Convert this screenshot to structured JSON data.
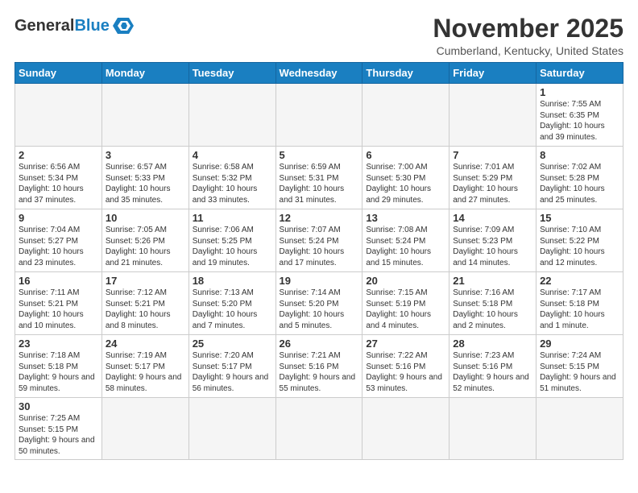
{
  "header": {
    "logo": {
      "text_general": "General",
      "text_blue": "Blue"
    },
    "title": "November 2025",
    "subtitle": "Cumberland, Kentucky, United States"
  },
  "days_of_week": [
    "Sunday",
    "Monday",
    "Tuesday",
    "Wednesday",
    "Thursday",
    "Friday",
    "Saturday"
  ],
  "weeks": [
    [
      {
        "day": "",
        "info": "",
        "empty": true
      },
      {
        "day": "",
        "info": "",
        "empty": true
      },
      {
        "day": "",
        "info": "",
        "empty": true
      },
      {
        "day": "",
        "info": "",
        "empty": true
      },
      {
        "day": "",
        "info": "",
        "empty": true
      },
      {
        "day": "",
        "info": "",
        "empty": true
      },
      {
        "day": "1",
        "info": "Sunrise: 7:55 AM\nSunset: 6:35 PM\nDaylight: 10 hours\nand 39 minutes."
      }
    ],
    [
      {
        "day": "2",
        "info": "Sunrise: 6:56 AM\nSunset: 5:34 PM\nDaylight: 10 hours\nand 37 minutes."
      },
      {
        "day": "3",
        "info": "Sunrise: 6:57 AM\nSunset: 5:33 PM\nDaylight: 10 hours\nand 35 minutes."
      },
      {
        "day": "4",
        "info": "Sunrise: 6:58 AM\nSunset: 5:32 PM\nDaylight: 10 hours\nand 33 minutes."
      },
      {
        "day": "5",
        "info": "Sunrise: 6:59 AM\nSunset: 5:31 PM\nDaylight: 10 hours\nand 31 minutes."
      },
      {
        "day": "6",
        "info": "Sunrise: 7:00 AM\nSunset: 5:30 PM\nDaylight: 10 hours\nand 29 minutes."
      },
      {
        "day": "7",
        "info": "Sunrise: 7:01 AM\nSunset: 5:29 PM\nDaylight: 10 hours\nand 27 minutes."
      },
      {
        "day": "8",
        "info": "Sunrise: 7:02 AM\nSunset: 5:28 PM\nDaylight: 10 hours\nand 25 minutes."
      }
    ],
    [
      {
        "day": "9",
        "info": "Sunrise: 7:04 AM\nSunset: 5:27 PM\nDaylight: 10 hours\nand 23 minutes."
      },
      {
        "day": "10",
        "info": "Sunrise: 7:05 AM\nSunset: 5:26 PM\nDaylight: 10 hours\nand 21 minutes."
      },
      {
        "day": "11",
        "info": "Sunrise: 7:06 AM\nSunset: 5:25 PM\nDaylight: 10 hours\nand 19 minutes."
      },
      {
        "day": "12",
        "info": "Sunrise: 7:07 AM\nSunset: 5:24 PM\nDaylight: 10 hours\nand 17 minutes."
      },
      {
        "day": "13",
        "info": "Sunrise: 7:08 AM\nSunset: 5:24 PM\nDaylight: 10 hours\nand 15 minutes."
      },
      {
        "day": "14",
        "info": "Sunrise: 7:09 AM\nSunset: 5:23 PM\nDaylight: 10 hours\nand 14 minutes."
      },
      {
        "day": "15",
        "info": "Sunrise: 7:10 AM\nSunset: 5:22 PM\nDaylight: 10 hours\nand 12 minutes."
      }
    ],
    [
      {
        "day": "16",
        "info": "Sunrise: 7:11 AM\nSunset: 5:21 PM\nDaylight: 10 hours\nand 10 minutes."
      },
      {
        "day": "17",
        "info": "Sunrise: 7:12 AM\nSunset: 5:21 PM\nDaylight: 10 hours\nand 8 minutes."
      },
      {
        "day": "18",
        "info": "Sunrise: 7:13 AM\nSunset: 5:20 PM\nDaylight: 10 hours\nand 7 minutes."
      },
      {
        "day": "19",
        "info": "Sunrise: 7:14 AM\nSunset: 5:20 PM\nDaylight: 10 hours\nand 5 minutes."
      },
      {
        "day": "20",
        "info": "Sunrise: 7:15 AM\nSunset: 5:19 PM\nDaylight: 10 hours\nand 4 minutes."
      },
      {
        "day": "21",
        "info": "Sunrise: 7:16 AM\nSunset: 5:18 PM\nDaylight: 10 hours\nand 2 minutes."
      },
      {
        "day": "22",
        "info": "Sunrise: 7:17 AM\nSunset: 5:18 PM\nDaylight: 10 hours\nand 1 minute."
      }
    ],
    [
      {
        "day": "23",
        "info": "Sunrise: 7:18 AM\nSunset: 5:18 PM\nDaylight: 9 hours\nand 59 minutes."
      },
      {
        "day": "24",
        "info": "Sunrise: 7:19 AM\nSunset: 5:17 PM\nDaylight: 9 hours\nand 58 minutes."
      },
      {
        "day": "25",
        "info": "Sunrise: 7:20 AM\nSunset: 5:17 PM\nDaylight: 9 hours\nand 56 minutes."
      },
      {
        "day": "26",
        "info": "Sunrise: 7:21 AM\nSunset: 5:16 PM\nDaylight: 9 hours\nand 55 minutes."
      },
      {
        "day": "27",
        "info": "Sunrise: 7:22 AM\nSunset: 5:16 PM\nDaylight: 9 hours\nand 53 minutes."
      },
      {
        "day": "28",
        "info": "Sunrise: 7:23 AM\nSunset: 5:16 PM\nDaylight: 9 hours\nand 52 minutes."
      },
      {
        "day": "29",
        "info": "Sunrise: 7:24 AM\nSunset: 5:15 PM\nDaylight: 9 hours\nand 51 minutes."
      }
    ],
    [
      {
        "day": "30",
        "info": "Sunrise: 7:25 AM\nSunset: 5:15 PM\nDaylight: 9 hours\nand 50 minutes."
      },
      {
        "day": "",
        "info": "",
        "empty": true
      },
      {
        "day": "",
        "info": "",
        "empty": true
      },
      {
        "day": "",
        "info": "",
        "empty": true
      },
      {
        "day": "",
        "info": "",
        "empty": true
      },
      {
        "day": "",
        "info": "",
        "empty": true
      },
      {
        "day": "",
        "info": "",
        "empty": true
      }
    ]
  ]
}
